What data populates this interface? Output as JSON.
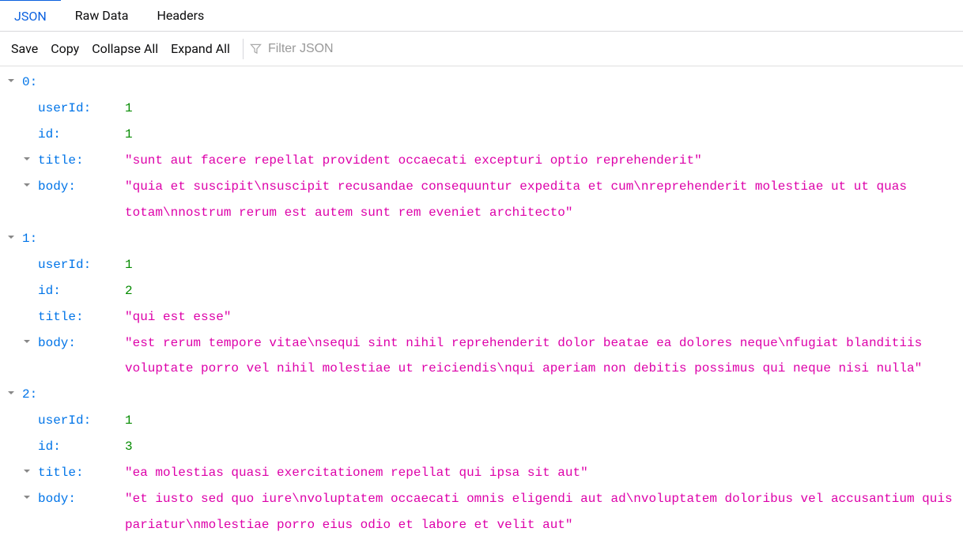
{
  "tabs": {
    "json": "JSON",
    "raw": "Raw Data",
    "headers": "Headers"
  },
  "toolbar": {
    "save": "Save",
    "copy": "Copy",
    "collapseAll": "Collapse All",
    "expandAll": "Expand All",
    "filterPlaceholder": "Filter JSON"
  },
  "items": [
    {
      "index": "0",
      "userId": "1",
      "id": "1",
      "title": "\"sunt aut facere repellat provident occaecati excepturi optio reprehenderit\"",
      "body": "\"quia et suscipit\\nsuscipit recusandae consequuntur expedita et cum\\nreprehenderit molestiae ut ut quas totam\\nnostrum rerum est autem sunt rem eveniet architecto\"",
      "titleExpandable": true,
      "bodyExpandable": true
    },
    {
      "index": "1",
      "userId": "1",
      "id": "2",
      "title": "\"qui est esse\"",
      "body": "\"est rerum tempore vitae\\nsequi sint nihil reprehenderit dolor beatae ea dolores neque\\nfugiat blanditiis voluptate porro vel nihil molestiae ut reiciendis\\nqui aperiam non debitis possimus qui neque nisi nulla\"",
      "titleExpandable": false,
      "bodyExpandable": true
    },
    {
      "index": "2",
      "userId": "1",
      "id": "3",
      "title": "\"ea molestias quasi exercitationem repellat qui ipsa sit aut\"",
      "body": "\"et iusto sed quo iure\\nvoluptatem occaecati omnis eligendi aut ad\\nvoluptatem doloribus vel accusantium quis pariatur\\nmolestiae porro eius odio et labore et velit aut\"",
      "titleExpandable": true,
      "bodyExpandable": true
    }
  ],
  "keyLabels": {
    "userId": "userId:",
    "id": "id:",
    "title": "title:",
    "body": "body:"
  }
}
